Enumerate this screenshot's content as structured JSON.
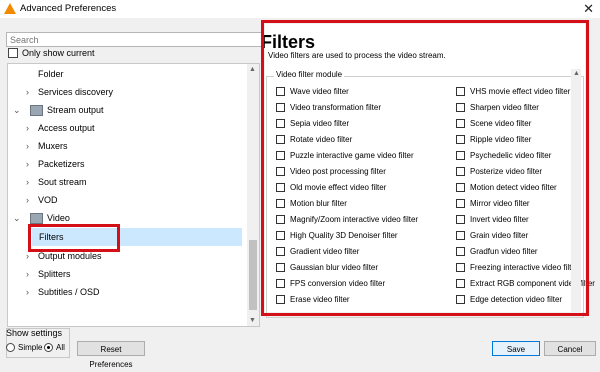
{
  "window": {
    "title": "Advanced Preferences",
    "close_glyph": "✕"
  },
  "search": {
    "placeholder": "Search"
  },
  "only_show_current": "Only show current",
  "tree": {
    "items": [
      {
        "label": "Folder"
      },
      {
        "label": "Services discovery"
      },
      {
        "label": "Stream output"
      },
      {
        "label": "Access output"
      },
      {
        "label": "Muxers"
      },
      {
        "label": "Packetizers"
      },
      {
        "label": "Sout stream"
      },
      {
        "label": "VOD"
      },
      {
        "label": "Video"
      },
      {
        "label": "Filters"
      },
      {
        "label": "Output modules"
      },
      {
        "label": "Splitters"
      },
      {
        "label": "Subtitles / OSD"
      }
    ]
  },
  "panel": {
    "title": "Filters",
    "description": "Video filters are used to process the video stream.",
    "group_title": "Video filter module",
    "left_filters": [
      "Wave video filter",
      "Video transformation filter",
      "Sepia video filter",
      "Rotate video filter",
      "Puzzle interactive game video filter",
      "Video post processing filter",
      "Old movie effect video filter",
      "Motion blur filter",
      "Magnify/Zoom interactive video filter",
      "High Quality 3D Denoiser filter",
      "Gradient video filter",
      "Gaussian blur video filter",
      "FPS conversion video filter",
      "Erase video filter"
    ],
    "right_filters": [
      "VHS movie effect video filter",
      "Sharpen video filter",
      "Scene video filter",
      "Ripple video filter",
      "Psychedelic video filter",
      "Posterize video filter",
      "Motion detect video filter",
      "Mirror video filter",
      "Invert video filter",
      "Grain video filter",
      "Gradfun video filter",
      "Freezing interactive video filter",
      "Extract RGB component video filter",
      "Edge detection video filter"
    ]
  },
  "show_settings": {
    "legend": "Show settings",
    "simple": "Simple",
    "all": "All",
    "selected": "All"
  },
  "buttons": {
    "reset": "Reset Preferences",
    "save": "Save",
    "cancel": "Cancel"
  },
  "colors": {
    "highlight": "#d40f17",
    "selection": "#cce8ff"
  }
}
